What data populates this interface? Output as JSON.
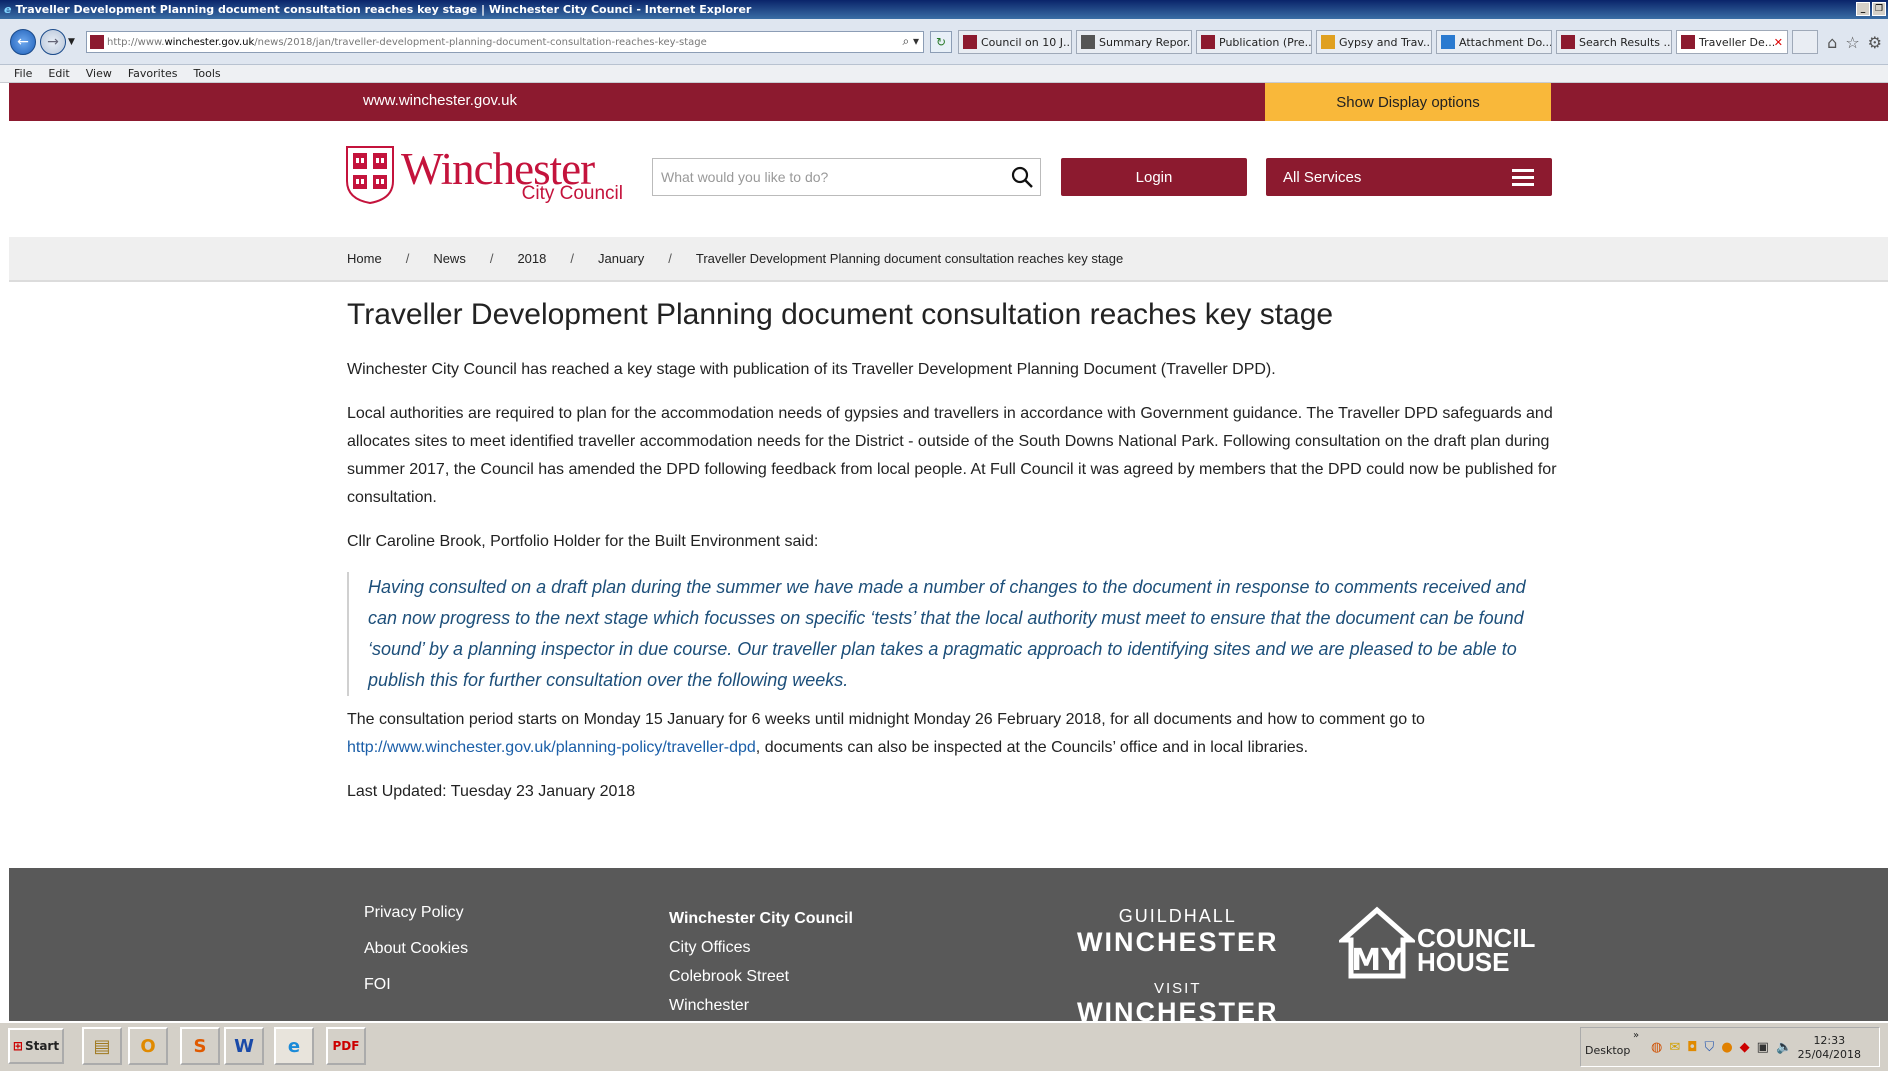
{
  "browser": {
    "window_title": "Traveller Development Planning document consultation reaches key stage | Winchester City Counci - Internet Explorer",
    "address_prefix": "http://www.",
    "address_host": "winchester.gov.uk",
    "address_path": "/news/2018/jan/traveller-development-planning-document-consultation-reaches-key-stage",
    "tabs": [
      {
        "label": "Council on 10 J..."
      },
      {
        "label": "Summary Repor..."
      },
      {
        "label": "Publication (Pre..."
      },
      {
        "label": "Gypsy and Trav..."
      },
      {
        "label": "Attachment Do..."
      },
      {
        "label": "Search Results ..."
      },
      {
        "label": "Traveller De..."
      }
    ],
    "menu": [
      "File",
      "Edit",
      "View",
      "Favorites",
      "Tools"
    ]
  },
  "site": {
    "url_label": "www.winchester.gov.uk",
    "display_options_label": "Show Display options",
    "logo_main": "Winchester",
    "logo_sub": "City Council",
    "search_placeholder": "What would you like to do?",
    "login_label": "Login",
    "services_label": "All Services",
    "brand_color": "#8c1a2f",
    "accent_color": "#f9b83a"
  },
  "breadcrumb": [
    "Home",
    "News",
    "2018",
    "January",
    "Traveller Development Planning document consultation reaches key stage"
  ],
  "article": {
    "title": "Traveller Development Planning document consultation reaches key stage",
    "p1": "Winchester City Council has reached a key stage with publication of its Traveller Development Planning Document (Traveller DPD).",
    "p2": "Local authorities are required to plan for the accommodation needs of gypsies and travellers in accordance with Government guidance. The Traveller DPD safeguards and allocates sites to meet identified traveller accommodation needs for the District - outside of the South Downs National Park. Following consultation on the draft plan during summer 2017, the Council has amended the DPD following feedback from local people. At Full Council it was agreed by members that the DPD could now be published for consultation.",
    "p3": "Cllr Caroline Brook, Portfolio Holder for the Built Environment said:",
    "quote": "Having consulted on a draft plan during the summer we have made a number of changes to the document in response to comments received and can now progress to the next stage which focusses on specific ‘tests’ that the local authority must meet to ensure that the document can be found ‘sound’ by a planning inspector in due course. Our traveller plan takes a pragmatic approach to identifying sites and we are pleased to be able to publish this for further consultation over the following weeks.",
    "p4_before": "The consultation period starts on Monday 15 January for 6 weeks until midnight Monday 26 February 2018, for all documents and how to comment go to ",
    "p4_link": "http://www.winchester.gov.uk/planning-policy/traveller-dpd",
    "p4_after": ", documents can also be inspected at the Councils’ office and in local libraries.",
    "last_updated": "Last Updated: Tuesday 23 January 2018"
  },
  "footer": {
    "links": [
      "Privacy Policy",
      "About Cookies",
      "FOI"
    ],
    "address": [
      "Winchester City Council",
      "City Offices",
      "Colebrook Street",
      "Winchester"
    ],
    "guildhall_line1": "GUILDHALL",
    "guildhall_line2": "WINCHESTER",
    "visit_line1": "VISIT",
    "visit_line2": "WINCHESTER",
    "mycouncil_line1": "COUNCIL",
    "mycouncil_line2": "HOUSE"
  },
  "taskbar": {
    "start_label": "Start",
    "desktop_label": "Desktop",
    "time": "12:33",
    "date": "25/04/2018"
  }
}
